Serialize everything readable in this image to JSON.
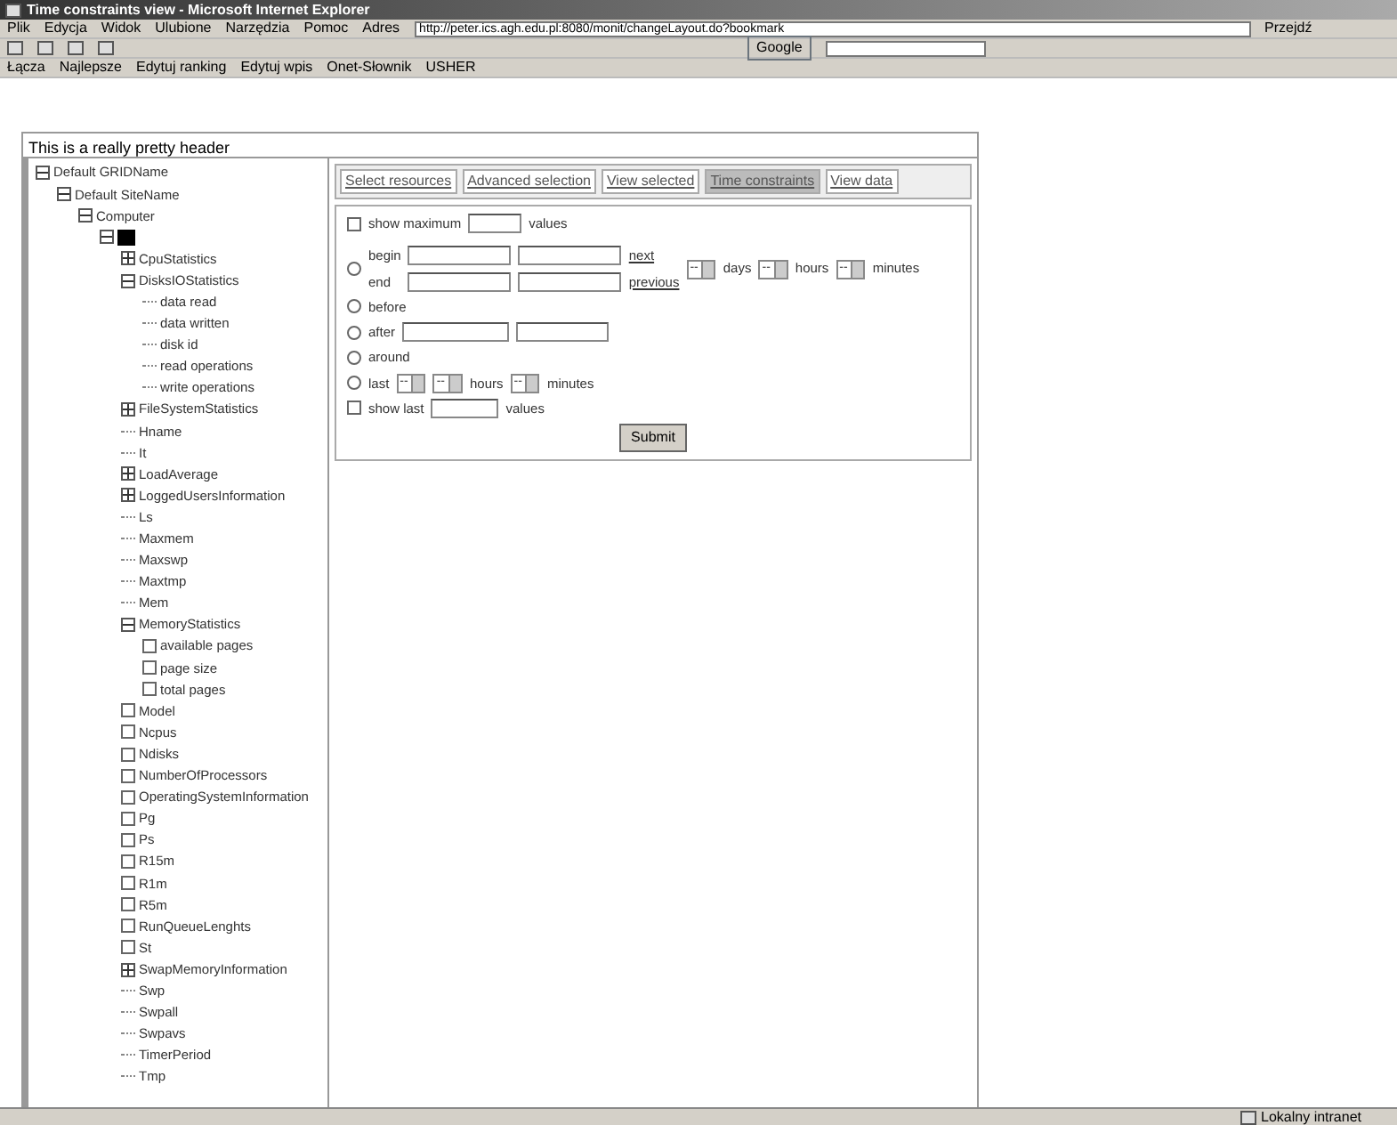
{
  "window": {
    "title": "Time constraints view - Microsoft Internet Explorer"
  },
  "menu": [
    "Plik",
    "Edycja",
    "Widok",
    "Ulubione",
    "Narzędzia",
    "Pomoc"
  ],
  "address": {
    "label": "Adres",
    "url": "http://peter.ics.agh.edu.pl:8080/monit/changeLayout.do?bookmark",
    "go": "Przejdź"
  },
  "links_bar": {
    "label": "Łącza",
    "links": [
      "Najlepsze",
      "Edytuj ranking",
      "Edytuj wpis",
      "Onet-Słownik",
      "USHER"
    ]
  },
  "search_bar": {
    "label": "Google"
  },
  "page_header": "This is a really pretty header",
  "tree": [
    {
      "label": "Default GRIDName",
      "kind": "group",
      "expanded": true,
      "selected": false,
      "children": [
        {
          "label": "Default SiteName",
          "kind": "group",
          "expanded": true,
          "selected": false,
          "children": [
            {
              "label": "Computer",
              "kind": "group",
              "expanded": true,
              "selected": false,
              "children": [
                {
                  "kind": "group",
                  "expanded": true,
                  "selected": true,
                  "children": [
                    {
                      "label": "CpuStatistics",
                      "kind": "group",
                      "expanded": false,
                      "selected": false
                    },
                    {
                      "label": "DisksIOStatistics",
                      "kind": "group",
                      "expanded": true,
                      "selected": false,
                      "children": [
                        {
                          "label": "data read",
                          "kind": "leaf",
                          "selected": false
                        },
                        {
                          "label": "data written",
                          "kind": "leaf",
                          "selected": false
                        },
                        {
                          "label": "disk id",
                          "kind": "leaf",
                          "selected": false
                        },
                        {
                          "label": "read operations",
                          "kind": "leaf",
                          "selected": false
                        },
                        {
                          "label": "write operations",
                          "kind": "leaf",
                          "selected": false
                        }
                      ]
                    },
                    {
                      "label": "FileSystemStatistics",
                      "kind": "group",
                      "expanded": false,
                      "selected": false
                    },
                    {
                      "label": "Hname",
                      "kind": "leaf",
                      "selected": false
                    },
                    {
                      "label": "It",
                      "kind": "leaf",
                      "selected": false
                    },
                    {
                      "label": "LoadAverage",
                      "kind": "group",
                      "expanded": false,
                      "selected": false
                    },
                    {
                      "label": "LoggedUsersInformation",
                      "kind": "group",
                      "expanded": false,
                      "selected": false
                    },
                    {
                      "label": "Ls",
                      "kind": "leaf",
                      "selected": false
                    },
                    {
                      "label": "Maxmem",
                      "kind": "leaf",
                      "selected": false
                    },
                    {
                      "label": "Maxswp",
                      "kind": "leaf",
                      "selected": false
                    },
                    {
                      "label": "Maxtmp",
                      "kind": "leaf",
                      "selected": false
                    },
                    {
                      "label": "Mem",
                      "kind": "leaf",
                      "selected": false
                    },
                    {
                      "label": "MemoryStatistics",
                      "kind": "group",
                      "expanded": true,
                      "selected": false,
                      "children": [
                        {
                          "label": "available pages",
                          "kind": "check",
                          "checked": false,
                          "selected": false
                        },
                        {
                          "label": "page size",
                          "kind": "check",
                          "checked": false,
                          "selected": false
                        },
                        {
                          "label": "total pages",
                          "kind": "check",
                          "checked": false,
                          "selected": false
                        }
                      ]
                    },
                    {
                      "label": "Model",
                      "kind": "check",
                      "checked": false,
                      "selected": false
                    },
                    {
                      "label": "Ncpus",
                      "kind": "check",
                      "checked": false,
                      "selected": false
                    },
                    {
                      "label": "Ndisks",
                      "kind": "check",
                      "checked": false,
                      "selected": false
                    },
                    {
                      "label": "NumberOfProcessors",
                      "kind": "check",
                      "checked": false,
                      "selected": false
                    },
                    {
                      "label": "OperatingSystemInformation",
                      "kind": "check",
                      "checked": false,
                      "selected": false
                    },
                    {
                      "label": "Pg",
                      "kind": "check",
                      "checked": false,
                      "selected": false
                    },
                    {
                      "label": "Ps",
                      "kind": "check",
                      "checked": false,
                      "selected": false
                    },
                    {
                      "label": "R15m",
                      "kind": "check",
                      "checked": false,
                      "selected": false
                    },
                    {
                      "label": "R1m",
                      "kind": "check",
                      "checked": false,
                      "selected": false
                    },
                    {
                      "label": "R5m",
                      "kind": "check",
                      "checked": false,
                      "selected": false
                    },
                    {
                      "label": "RunQueueLenghts",
                      "kind": "check",
                      "checked": false,
                      "selected": false
                    },
                    {
                      "label": "St",
                      "kind": "check",
                      "checked": false,
                      "selected": false
                    },
                    {
                      "label": "SwapMemoryInformation",
                      "kind": "group",
                      "expanded": false,
                      "selected": false
                    },
                    {
                      "label": "Swp",
                      "kind": "leaf",
                      "selected": false
                    },
                    {
                      "label": "Swpall",
                      "kind": "leaf",
                      "selected": false
                    },
                    {
                      "label": "Swpavs",
                      "kind": "leaf",
                      "selected": false
                    },
                    {
                      "label": "TimerPeriod",
                      "kind": "leaf",
                      "selected": false
                    },
                    {
                      "label": "Tmp",
                      "kind": "leaf",
                      "selected": false
                    }
                  ]
                }
              ]
            }
          ]
        }
      ]
    }
  ],
  "tabs": [
    {
      "label": "Select resources",
      "selected": false
    },
    {
      "label": "Advanced selection",
      "selected": false
    },
    {
      "label": "View selected",
      "selected": false
    },
    {
      "label": "Time constraints",
      "selected": true
    },
    {
      "label": "View data",
      "selected": false
    }
  ],
  "form": {
    "show_max": {
      "checked": false,
      "label": "show maximum",
      "suffix": "values"
    },
    "range": {
      "selected": false,
      "begin": "begin",
      "end": "end",
      "next": "next",
      "previous": "previous",
      "select": "--",
      "days": "days",
      "hours": "hours",
      "minutes": "minutes"
    },
    "before": {
      "selected": false,
      "label": "before"
    },
    "after": {
      "selected": false,
      "label": "after"
    },
    "around": {
      "selected": false,
      "label": "around"
    },
    "last": {
      "selected": false,
      "label": "last",
      "select": "--",
      "hours": "hours",
      "minutes": "minutes"
    },
    "show_last": {
      "checked": false,
      "label": "show last",
      "suffix": "values"
    },
    "submit": "Submit"
  },
  "status_bar": {
    "zone": "Lokalny intranet"
  }
}
